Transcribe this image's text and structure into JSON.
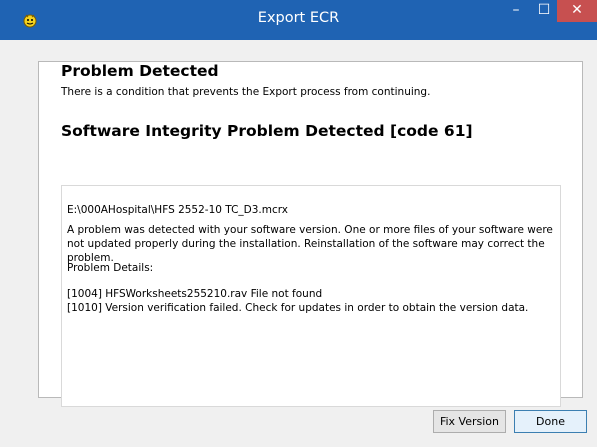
{
  "window": {
    "title": "Export ECR",
    "minimize": "–",
    "maximize": "☐",
    "close": "✕"
  },
  "header": {
    "title": "Problem Detected",
    "subtitle": "There is a condition that prevents the Export process from continuing."
  },
  "problem": {
    "title": "Software Integrity Problem Detected [code 61]",
    "file_path": "E:\\000AHospital\\HFS 2552-10 TC_D3.mcrx",
    "description": "A problem was detected with your software version. One or more files of your software were not updated properly during the installation. Reinstallation of the software may correct the problem.",
    "details_label": "Problem Details:",
    "details": [
      "[1004]  HFSWorksheets255210.rav   File not found",
      "[1010]  Version verification failed. Check for updates in order to obtain the version data."
    ]
  },
  "buttons": {
    "fix_version": "Fix Version",
    "done": "Done"
  }
}
